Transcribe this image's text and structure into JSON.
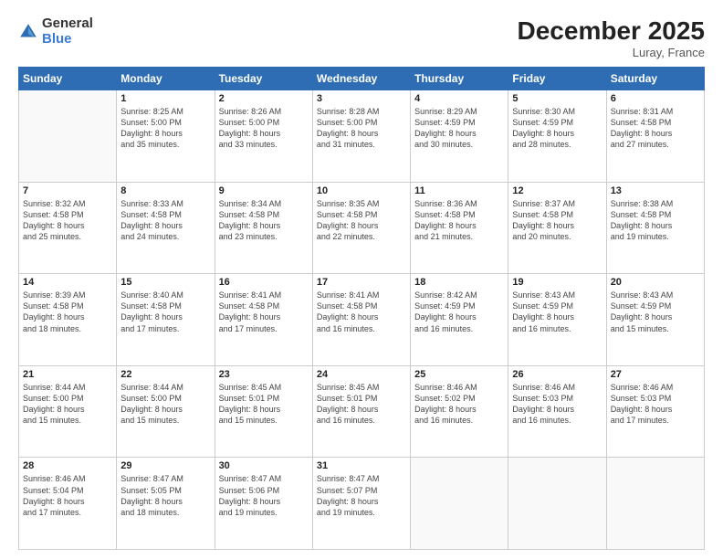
{
  "logo": {
    "general": "General",
    "blue": "Blue"
  },
  "title": "December 2025",
  "location": "Luray, France",
  "days_of_week": [
    "Sunday",
    "Monday",
    "Tuesday",
    "Wednesday",
    "Thursday",
    "Friday",
    "Saturday"
  ],
  "weeks": [
    [
      {
        "day": "",
        "info": ""
      },
      {
        "day": "1",
        "info": "Sunrise: 8:25 AM\nSunset: 5:00 PM\nDaylight: 8 hours\nand 35 minutes."
      },
      {
        "day": "2",
        "info": "Sunrise: 8:26 AM\nSunset: 5:00 PM\nDaylight: 8 hours\nand 33 minutes."
      },
      {
        "day": "3",
        "info": "Sunrise: 8:28 AM\nSunset: 5:00 PM\nDaylight: 8 hours\nand 31 minutes."
      },
      {
        "day": "4",
        "info": "Sunrise: 8:29 AM\nSunset: 4:59 PM\nDaylight: 8 hours\nand 30 minutes."
      },
      {
        "day": "5",
        "info": "Sunrise: 8:30 AM\nSunset: 4:59 PM\nDaylight: 8 hours\nand 28 minutes."
      },
      {
        "day": "6",
        "info": "Sunrise: 8:31 AM\nSunset: 4:58 PM\nDaylight: 8 hours\nand 27 minutes."
      }
    ],
    [
      {
        "day": "7",
        "info": "Sunrise: 8:32 AM\nSunset: 4:58 PM\nDaylight: 8 hours\nand 25 minutes."
      },
      {
        "day": "8",
        "info": "Sunrise: 8:33 AM\nSunset: 4:58 PM\nDaylight: 8 hours\nand 24 minutes."
      },
      {
        "day": "9",
        "info": "Sunrise: 8:34 AM\nSunset: 4:58 PM\nDaylight: 8 hours\nand 23 minutes."
      },
      {
        "day": "10",
        "info": "Sunrise: 8:35 AM\nSunset: 4:58 PM\nDaylight: 8 hours\nand 22 minutes."
      },
      {
        "day": "11",
        "info": "Sunrise: 8:36 AM\nSunset: 4:58 PM\nDaylight: 8 hours\nand 21 minutes."
      },
      {
        "day": "12",
        "info": "Sunrise: 8:37 AM\nSunset: 4:58 PM\nDaylight: 8 hours\nand 20 minutes."
      },
      {
        "day": "13",
        "info": "Sunrise: 8:38 AM\nSunset: 4:58 PM\nDaylight: 8 hours\nand 19 minutes."
      }
    ],
    [
      {
        "day": "14",
        "info": "Sunrise: 8:39 AM\nSunset: 4:58 PM\nDaylight: 8 hours\nand 18 minutes."
      },
      {
        "day": "15",
        "info": "Sunrise: 8:40 AM\nSunset: 4:58 PM\nDaylight: 8 hours\nand 17 minutes."
      },
      {
        "day": "16",
        "info": "Sunrise: 8:41 AM\nSunset: 4:58 PM\nDaylight: 8 hours\nand 17 minutes."
      },
      {
        "day": "17",
        "info": "Sunrise: 8:41 AM\nSunset: 4:58 PM\nDaylight: 8 hours\nand 16 minutes."
      },
      {
        "day": "18",
        "info": "Sunrise: 8:42 AM\nSunset: 4:59 PM\nDaylight: 8 hours\nand 16 minutes."
      },
      {
        "day": "19",
        "info": "Sunrise: 8:43 AM\nSunset: 4:59 PM\nDaylight: 8 hours\nand 16 minutes."
      },
      {
        "day": "20",
        "info": "Sunrise: 8:43 AM\nSunset: 4:59 PM\nDaylight: 8 hours\nand 15 minutes."
      }
    ],
    [
      {
        "day": "21",
        "info": "Sunrise: 8:44 AM\nSunset: 5:00 PM\nDaylight: 8 hours\nand 15 minutes."
      },
      {
        "day": "22",
        "info": "Sunrise: 8:44 AM\nSunset: 5:00 PM\nDaylight: 8 hours\nand 15 minutes."
      },
      {
        "day": "23",
        "info": "Sunrise: 8:45 AM\nSunset: 5:01 PM\nDaylight: 8 hours\nand 15 minutes."
      },
      {
        "day": "24",
        "info": "Sunrise: 8:45 AM\nSunset: 5:01 PM\nDaylight: 8 hours\nand 16 minutes."
      },
      {
        "day": "25",
        "info": "Sunrise: 8:46 AM\nSunset: 5:02 PM\nDaylight: 8 hours\nand 16 minutes."
      },
      {
        "day": "26",
        "info": "Sunrise: 8:46 AM\nSunset: 5:03 PM\nDaylight: 8 hours\nand 16 minutes."
      },
      {
        "day": "27",
        "info": "Sunrise: 8:46 AM\nSunset: 5:03 PM\nDaylight: 8 hours\nand 17 minutes."
      }
    ],
    [
      {
        "day": "28",
        "info": "Sunrise: 8:46 AM\nSunset: 5:04 PM\nDaylight: 8 hours\nand 17 minutes."
      },
      {
        "day": "29",
        "info": "Sunrise: 8:47 AM\nSunset: 5:05 PM\nDaylight: 8 hours\nand 18 minutes."
      },
      {
        "day": "30",
        "info": "Sunrise: 8:47 AM\nSunset: 5:06 PM\nDaylight: 8 hours\nand 19 minutes."
      },
      {
        "day": "31",
        "info": "Sunrise: 8:47 AM\nSunset: 5:07 PM\nDaylight: 8 hours\nand 19 minutes."
      },
      {
        "day": "",
        "info": ""
      },
      {
        "day": "",
        "info": ""
      },
      {
        "day": "",
        "info": ""
      }
    ]
  ]
}
